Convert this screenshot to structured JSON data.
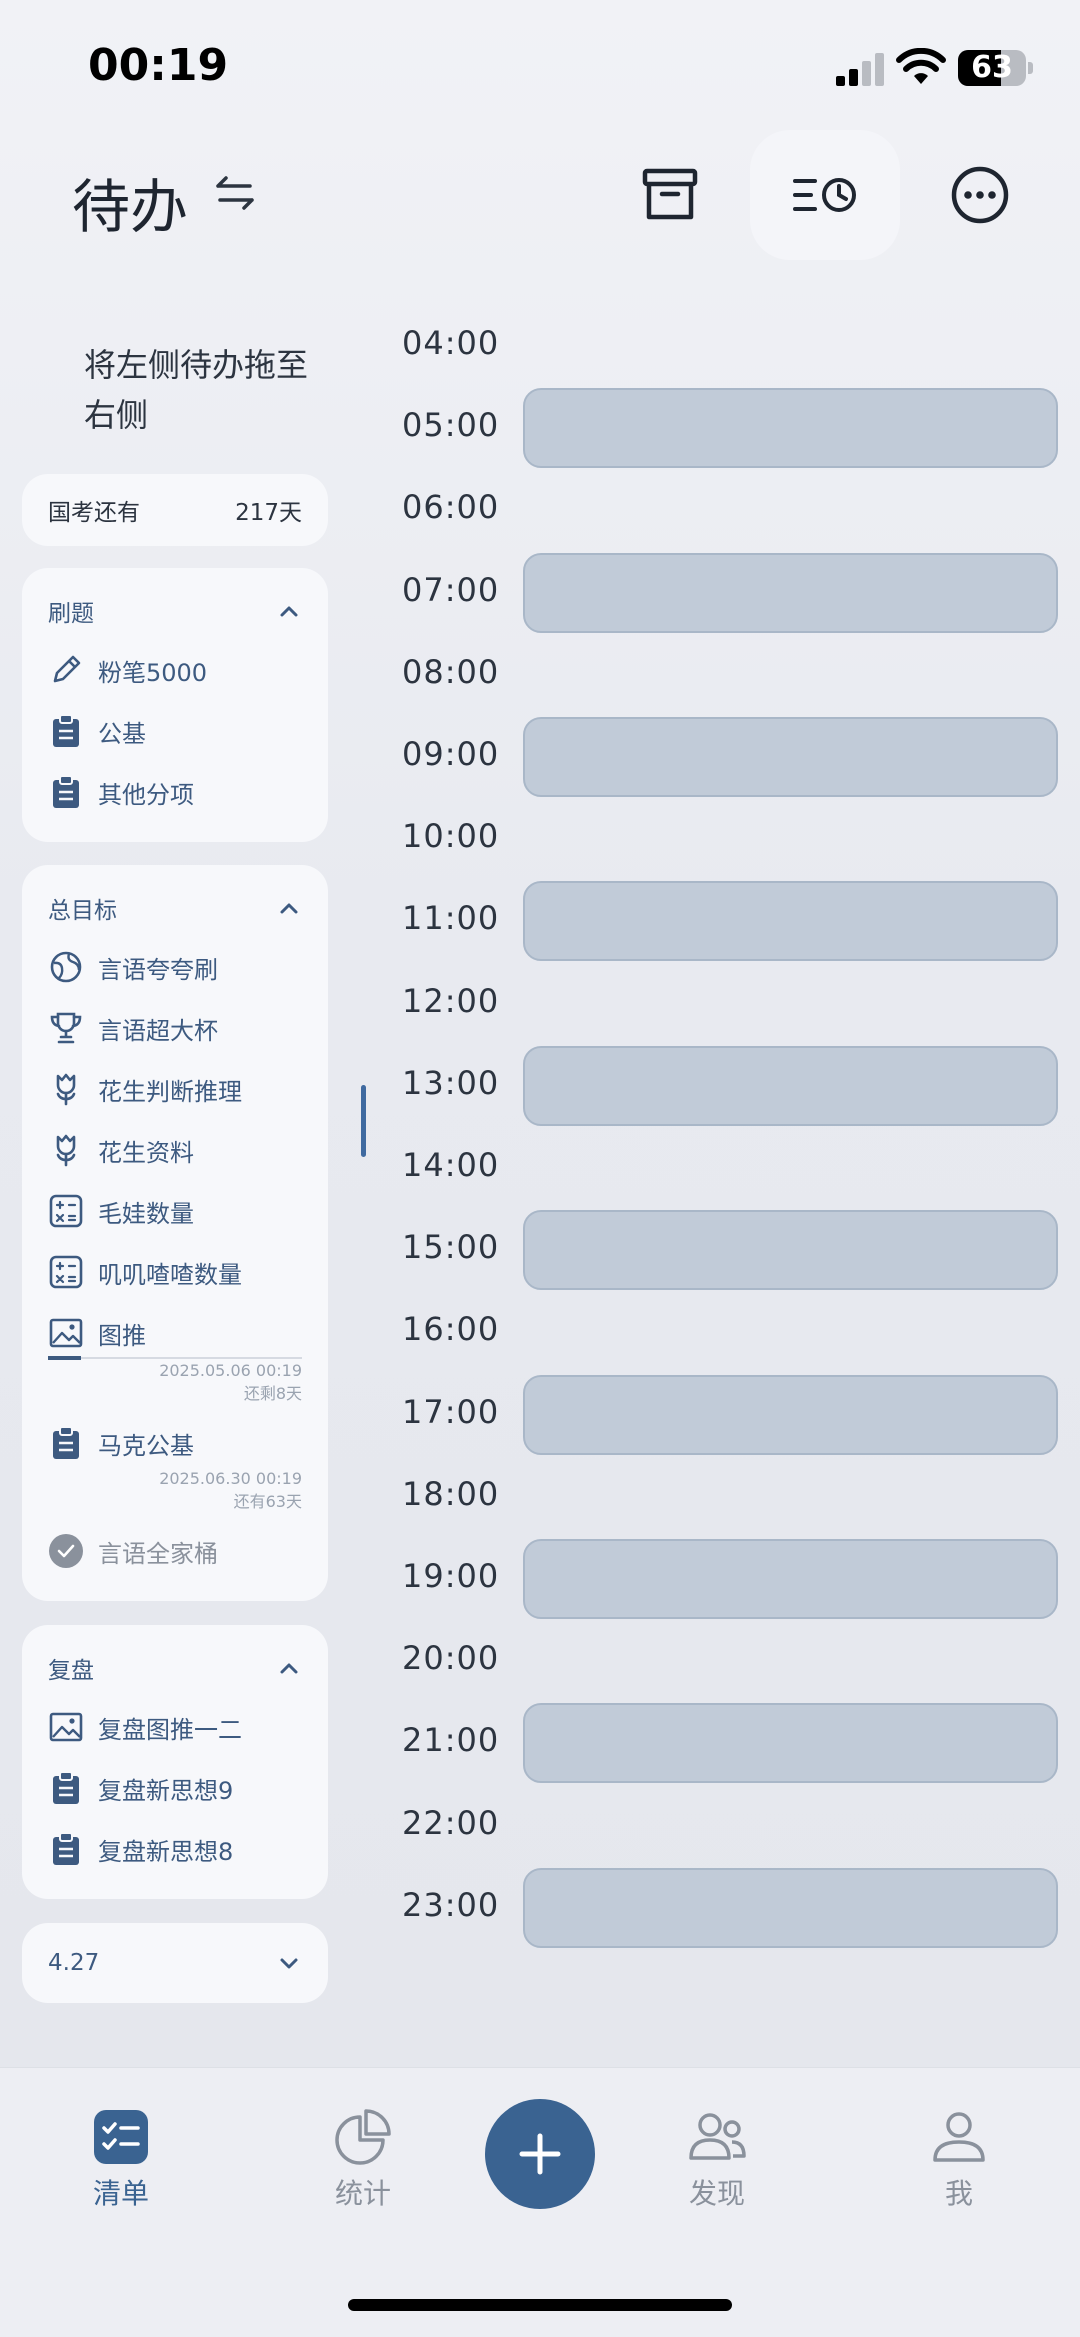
{
  "status": {
    "time": "00:19",
    "battery": "63",
    "battery_level": 0.63
  },
  "header": {
    "title": "待办"
  },
  "left": {
    "hint": "将左侧待办拖至右侧",
    "countdown": {
      "label": "国考还有",
      "value": "217天"
    },
    "groups": [
      {
        "title": "刷题",
        "items": [
          {
            "label": "粉笔5000",
            "icon": "pencil-icon"
          },
          {
            "label": "公基",
            "icon": "clipboard-icon"
          },
          {
            "label": "其他分项",
            "icon": "clipboard-icon"
          }
        ]
      },
      {
        "title": "总目标",
        "items": [
          {
            "label": "言语夸夸刷",
            "icon": "globe-icon"
          },
          {
            "label": "言语超大杯",
            "icon": "trophy-icon"
          },
          {
            "label": "花生判断推理",
            "icon": "flower-icon"
          },
          {
            "label": "花生资料",
            "icon": "flower-icon"
          },
          {
            "label": "毛娃数量",
            "icon": "calculator-icon"
          },
          {
            "label": "叽叽喳喳数量",
            "icon": "calculator-icon"
          },
          {
            "label": "图推",
            "icon": "image-icon",
            "date": "2025.05.06 00:19",
            "remaining": "还剩8天",
            "progress": 0.13
          },
          {
            "label": "马克公基",
            "icon": "clipboard-icon",
            "date": "2025.06.30 00:19",
            "remaining": "还有63天"
          },
          {
            "label": "言语全家桶",
            "icon": "check-circle-icon",
            "done": true
          }
        ]
      },
      {
        "title": "复盘",
        "items": [
          {
            "label": "复盘图推一二",
            "icon": "image-icon"
          },
          {
            "label": "复盘新思想9",
            "icon": "clipboard-icon"
          },
          {
            "label": "复盘新思想8",
            "icon": "clipboard-icon"
          }
        ]
      },
      {
        "title": "4.27",
        "collapsed": true,
        "items": []
      }
    ]
  },
  "timeline": {
    "hours": [
      "04:00",
      "05:00",
      "06:00",
      "07:00",
      "08:00",
      "09:00",
      "10:00",
      "11:00",
      "12:00",
      "13:00",
      "14:00",
      "15:00",
      "16:00",
      "17:00",
      "18:00",
      "19:00",
      "20:00",
      "21:00",
      "22:00",
      "23:00"
    ],
    "filled": [
      "05:00",
      "07:00",
      "09:00",
      "11:00",
      "13:00",
      "15:00",
      "17:00",
      "19:00",
      "21:00",
      "23:00"
    ]
  },
  "tabbar": {
    "tabs": [
      {
        "label": "清单",
        "icon": "checklist-icon",
        "active": true
      },
      {
        "label": "统计",
        "icon": "pie-chart-icon"
      },
      {
        "label": "发现",
        "icon": "people-icon"
      },
      {
        "label": "我",
        "icon": "user-icon"
      }
    ]
  },
  "colors": {
    "accent": "#3a6391",
    "item_text": "#3d5a80",
    "slot": "#c1cbd8"
  }
}
